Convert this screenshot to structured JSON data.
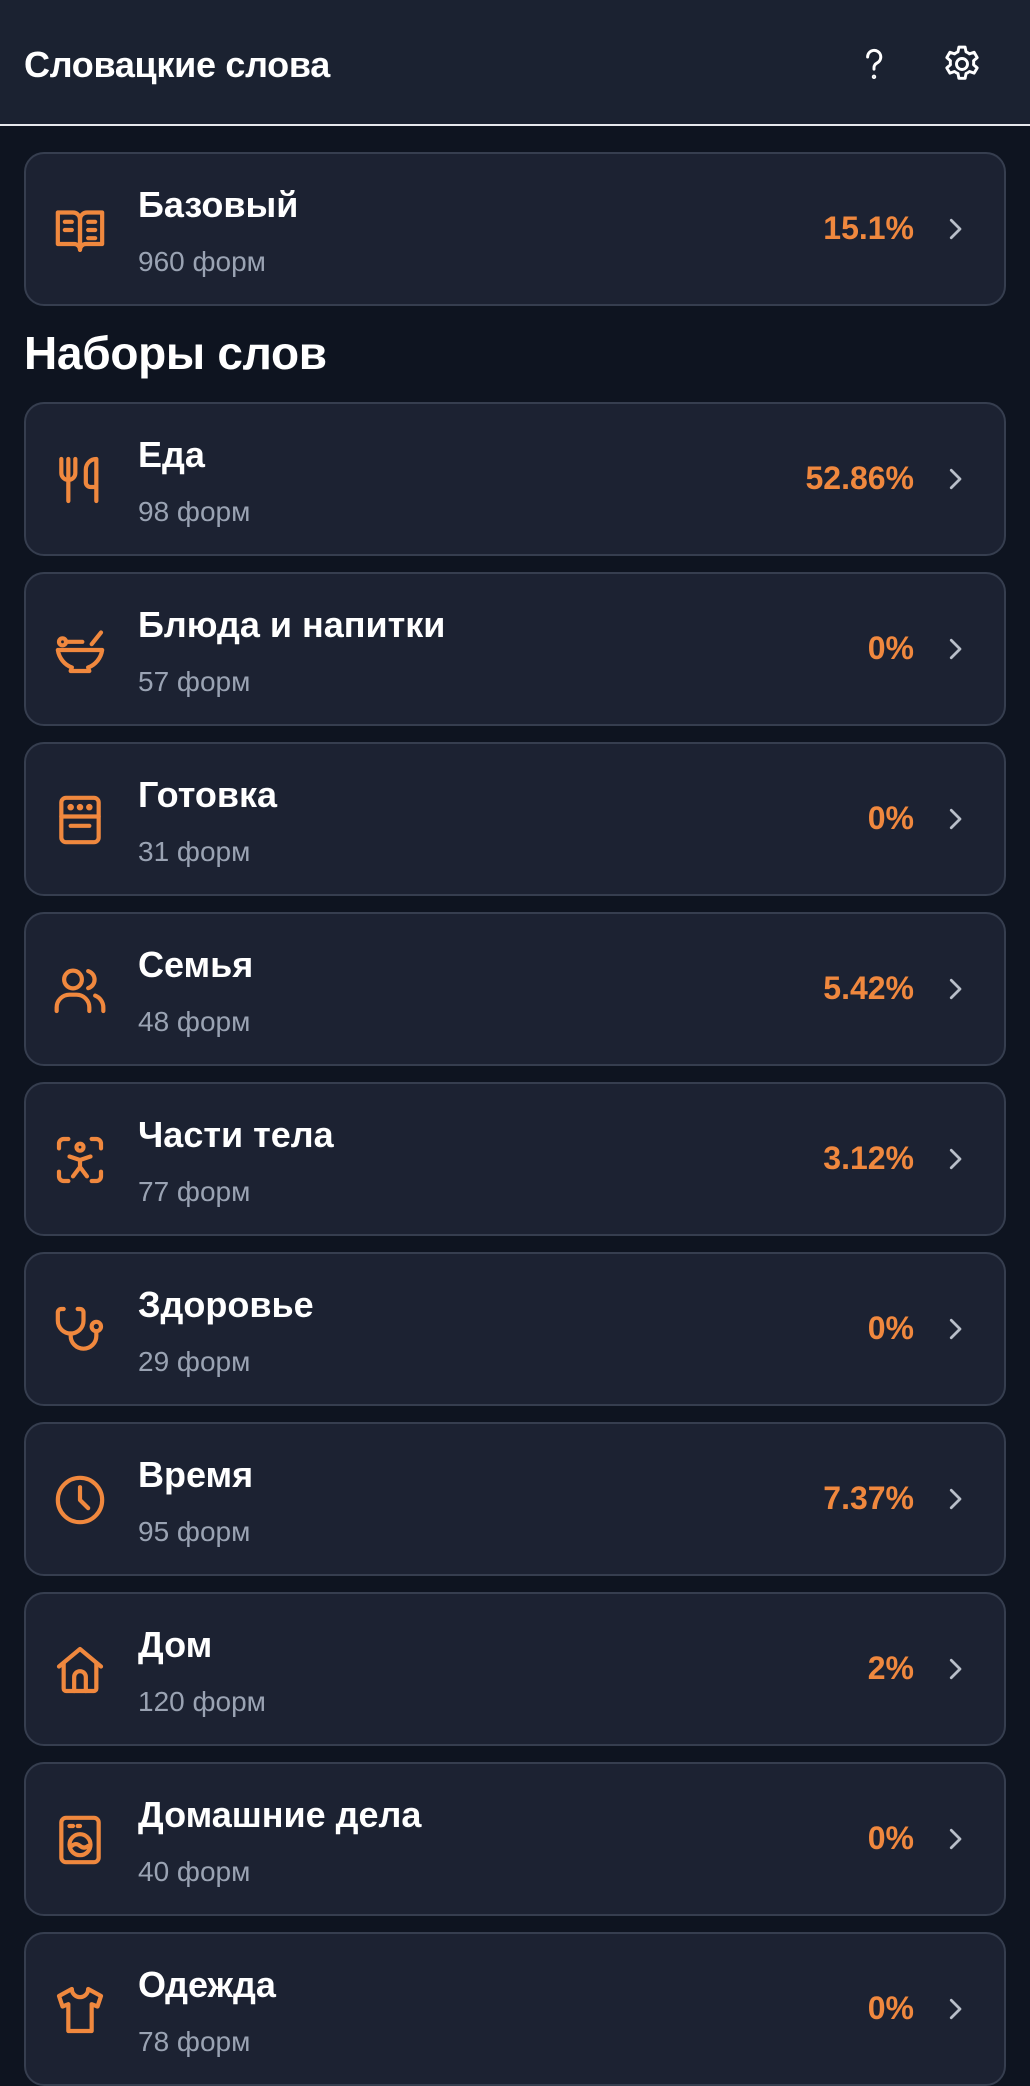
{
  "header": {
    "title": "Словацкие слова",
    "help_icon": "help-icon",
    "settings_icon": "gear-icon"
  },
  "colors": {
    "accent": "#f0883e",
    "card_bg": "#1c2232",
    "page_bg": "#0e1420",
    "muted_text": "#9aa3b3"
  },
  "basic": {
    "title": "Базовый",
    "subtitle": "960 форм",
    "percent": "15.1%",
    "icon": "book-icon"
  },
  "section": {
    "title": "Наборы слов"
  },
  "sets": [
    {
      "title": "Еда",
      "subtitle": "98 форм",
      "percent": "52.86%",
      "icon": "utensils-icon"
    },
    {
      "title": "Блюда и напитки",
      "subtitle": "57 форм",
      "percent": "0%",
      "icon": "bowl-icon"
    },
    {
      "title": "Готовка",
      "subtitle": "31 форм",
      "percent": "0%",
      "icon": "stove-icon"
    },
    {
      "title": "Семья",
      "subtitle": "48 форм",
      "percent": "5.42%",
      "icon": "users-icon"
    },
    {
      "title": "Части тела",
      "subtitle": "77 форм",
      "percent": "3.12%",
      "icon": "body-scan-icon"
    },
    {
      "title": "Здоровье",
      "subtitle": "29 форм",
      "percent": "0%",
      "icon": "stethoscope-icon"
    },
    {
      "title": "Время",
      "subtitle": "95 форм",
      "percent": "7.37%",
      "icon": "clock-icon"
    },
    {
      "title": "Дом",
      "subtitle": "120 форм",
      "percent": "2%",
      "icon": "house-icon"
    },
    {
      "title": "Домашние дела",
      "subtitle": "40 форм",
      "percent": "0%",
      "icon": "washing-machine-icon"
    },
    {
      "title": "Одежда",
      "subtitle": "78 форм",
      "percent": "0%",
      "icon": "shirt-icon"
    }
  ]
}
